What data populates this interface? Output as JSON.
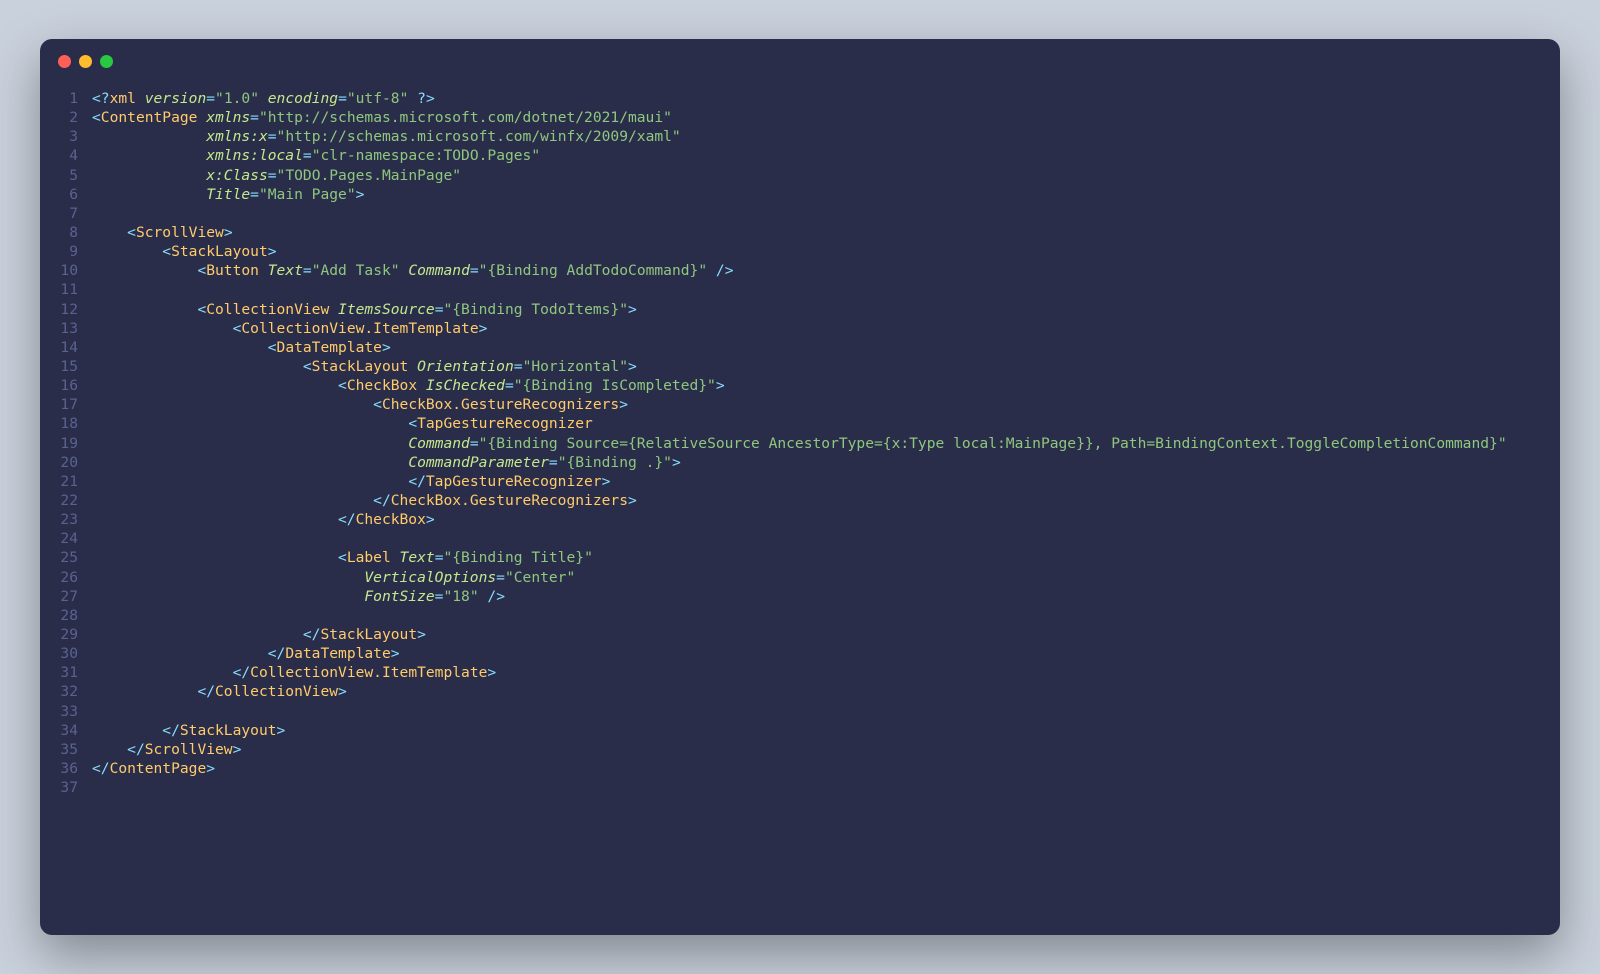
{
  "window": {
    "traffic_lights": [
      "close",
      "minimize",
      "zoom"
    ]
  },
  "line_count": 37,
  "code_lines": [
    [
      [
        "p",
        "<?"
      ],
      [
        "tg",
        "xml "
      ],
      [
        "at",
        "version"
      ],
      [
        "op",
        "="
      ],
      [
        "st",
        "\"1.0\""
      ],
      [
        "at",
        " encoding"
      ],
      [
        "op",
        "="
      ],
      [
        "st",
        "\"utf-8\" "
      ],
      [
        "p",
        "?>"
      ]
    ],
    [
      [
        "p",
        "<"
      ],
      [
        "tg",
        "ContentPage "
      ],
      [
        "at",
        "xmlns"
      ],
      [
        "op",
        "="
      ],
      [
        "st",
        "\"http://schemas.microsoft.com/dotnet/2021/maui\""
      ]
    ],
    [
      [
        "",
        "             "
      ],
      [
        "at",
        "xmlns:x"
      ],
      [
        "op",
        "="
      ],
      [
        "st",
        "\"http://schemas.microsoft.com/winfx/2009/xaml\""
      ]
    ],
    [
      [
        "",
        "             "
      ],
      [
        "at",
        "xmlns:local"
      ],
      [
        "op",
        "="
      ],
      [
        "st",
        "\"clr-namespace:TODO.Pages\""
      ]
    ],
    [
      [
        "",
        "             "
      ],
      [
        "at",
        "x:Class"
      ],
      [
        "op",
        "="
      ],
      [
        "st",
        "\"TODO.Pages.MainPage\""
      ]
    ],
    [
      [
        "",
        "             "
      ],
      [
        "at",
        "Title"
      ],
      [
        "op",
        "="
      ],
      [
        "st",
        "\"Main Page\""
      ],
      [
        "p",
        ">"
      ]
    ],
    [
      [
        "",
        ""
      ]
    ],
    [
      [
        "",
        "    "
      ],
      [
        "p",
        "<"
      ],
      [
        "tg",
        "ScrollView"
      ],
      [
        "p",
        ">"
      ]
    ],
    [
      [
        "",
        "        "
      ],
      [
        "p",
        "<"
      ],
      [
        "tg",
        "StackLayout"
      ],
      [
        "p",
        ">"
      ]
    ],
    [
      [
        "",
        "            "
      ],
      [
        "p",
        "<"
      ],
      [
        "tg",
        "Button "
      ],
      [
        "at",
        "Text"
      ],
      [
        "op",
        "="
      ],
      [
        "st",
        "\"Add Task\""
      ],
      [
        "at",
        " Command"
      ],
      [
        "op",
        "="
      ],
      [
        "st",
        "\"{Binding AddTodoCommand}\""
      ],
      [
        "p",
        " />"
      ]
    ],
    [
      [
        "",
        ""
      ]
    ],
    [
      [
        "",
        "            "
      ],
      [
        "p",
        "<"
      ],
      [
        "tg",
        "CollectionView "
      ],
      [
        "at",
        "ItemsSource"
      ],
      [
        "op",
        "="
      ],
      [
        "st",
        "\"{Binding TodoItems}\""
      ],
      [
        "p",
        ">"
      ]
    ],
    [
      [
        "",
        "                "
      ],
      [
        "p",
        "<"
      ],
      [
        "tg",
        "CollectionView.ItemTemplate"
      ],
      [
        "p",
        ">"
      ]
    ],
    [
      [
        "",
        "                    "
      ],
      [
        "p",
        "<"
      ],
      [
        "tg",
        "DataTemplate"
      ],
      [
        "p",
        ">"
      ]
    ],
    [
      [
        "",
        "                        "
      ],
      [
        "p",
        "<"
      ],
      [
        "tg",
        "StackLayout "
      ],
      [
        "at",
        "Orientation"
      ],
      [
        "op",
        "="
      ],
      [
        "st",
        "\"Horizontal\""
      ],
      [
        "p",
        ">"
      ]
    ],
    [
      [
        "",
        "                            "
      ],
      [
        "p",
        "<"
      ],
      [
        "tg",
        "CheckBox "
      ],
      [
        "at",
        "IsChecked"
      ],
      [
        "op",
        "="
      ],
      [
        "st",
        "\"{Binding IsCompleted}\""
      ],
      [
        "p",
        ">"
      ]
    ],
    [
      [
        "",
        "                                "
      ],
      [
        "p",
        "<"
      ],
      [
        "tg",
        "CheckBox.GestureRecognizers"
      ],
      [
        "p",
        ">"
      ]
    ],
    [
      [
        "",
        "                                    "
      ],
      [
        "p",
        "<"
      ],
      [
        "tg",
        "TapGestureRecognizer"
      ]
    ],
    [
      [
        "",
        "                                    "
      ],
      [
        "at",
        "Command"
      ],
      [
        "op",
        "="
      ],
      [
        "st",
        "\"{Binding Source={RelativeSource AncestorType={x:Type local:MainPage}}, Path=BindingContext.ToggleCompletionCommand}\""
      ]
    ],
    [
      [
        "",
        "                                    "
      ],
      [
        "at",
        "CommandParameter"
      ],
      [
        "op",
        "="
      ],
      [
        "st",
        "\"{Binding .}\""
      ],
      [
        "p",
        ">"
      ]
    ],
    [
      [
        "",
        "                                    "
      ],
      [
        "p",
        "</"
      ],
      [
        "tg",
        "TapGestureRecognizer"
      ],
      [
        "p",
        ">"
      ]
    ],
    [
      [
        "",
        "                                "
      ],
      [
        "p",
        "</"
      ],
      [
        "tg",
        "CheckBox.GestureRecognizers"
      ],
      [
        "p",
        ">"
      ]
    ],
    [
      [
        "",
        "                            "
      ],
      [
        "p",
        "</"
      ],
      [
        "tg",
        "CheckBox"
      ],
      [
        "p",
        ">"
      ]
    ],
    [
      [
        "",
        ""
      ]
    ],
    [
      [
        "",
        "                            "
      ],
      [
        "p",
        "<"
      ],
      [
        "tg",
        "Label "
      ],
      [
        "at",
        "Text"
      ],
      [
        "op",
        "="
      ],
      [
        "st",
        "\"{Binding Title}\""
      ]
    ],
    [
      [
        "",
        "                               "
      ],
      [
        "at",
        "VerticalOptions"
      ],
      [
        "op",
        "="
      ],
      [
        "st",
        "\"Center\""
      ]
    ],
    [
      [
        "",
        "                               "
      ],
      [
        "at",
        "FontSize"
      ],
      [
        "op",
        "="
      ],
      [
        "st",
        "\"18\""
      ],
      [
        "p",
        " />"
      ]
    ],
    [
      [
        "",
        ""
      ]
    ],
    [
      [
        "",
        "                        "
      ],
      [
        "p",
        "</"
      ],
      [
        "tg",
        "StackLayout"
      ],
      [
        "p",
        ">"
      ]
    ],
    [
      [
        "",
        "                    "
      ],
      [
        "p",
        "</"
      ],
      [
        "tg",
        "DataTemplate"
      ],
      [
        "p",
        ">"
      ]
    ],
    [
      [
        "",
        "                "
      ],
      [
        "p",
        "</"
      ],
      [
        "tg",
        "CollectionView.ItemTemplate"
      ],
      [
        "p",
        ">"
      ]
    ],
    [
      [
        "",
        "            "
      ],
      [
        "p",
        "</"
      ],
      [
        "tg",
        "CollectionView"
      ],
      [
        "p",
        ">"
      ]
    ],
    [
      [
        "",
        ""
      ]
    ],
    [
      [
        "",
        "        "
      ],
      [
        "p",
        "</"
      ],
      [
        "tg",
        "StackLayout"
      ],
      [
        "p",
        ">"
      ]
    ],
    [
      [
        "",
        "    "
      ],
      [
        "p",
        "</"
      ],
      [
        "tg",
        "ScrollView"
      ],
      [
        "p",
        ">"
      ]
    ],
    [
      [
        "p",
        "</"
      ],
      [
        "tg",
        "ContentPage"
      ],
      [
        "p",
        ">"
      ]
    ],
    [
      [
        "",
        ""
      ]
    ]
  ]
}
